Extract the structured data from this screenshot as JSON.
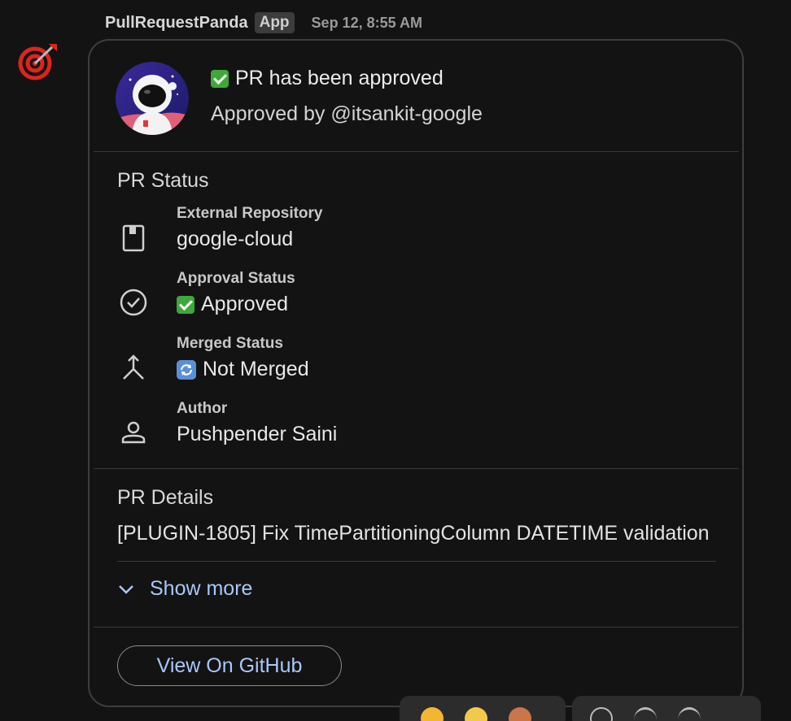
{
  "message": {
    "sender": "PullRequestPanda",
    "badge": "App",
    "timestamp": "Sep 12, 8:55 AM"
  },
  "card": {
    "title": "PR has been approved",
    "subtitle": "Approved by @itsankit-google",
    "status_section": {
      "title": "PR Status",
      "items": [
        {
          "label": "External Repository",
          "value": "google-cloud",
          "icon": "repository-icon"
        },
        {
          "label": "Approval Status",
          "value": "Approved",
          "icon": "check-circle-icon"
        },
        {
          "label": "Merged Status",
          "value": "Not Merged",
          "icon": "merge-icon"
        },
        {
          "label": "Author",
          "value": "Pushpender Saini",
          "icon": "person-icon"
        }
      ]
    },
    "details_section": {
      "title": "PR Details",
      "text": "[PLUGIN-1805] Fix TimePartitioningColumn DATETIME validation",
      "show_more_label": "Show more"
    },
    "button_label": "View On GitHub"
  },
  "colors": {
    "link": "#a8c7fa",
    "background": "#131313",
    "border": "#3e3e3e"
  }
}
